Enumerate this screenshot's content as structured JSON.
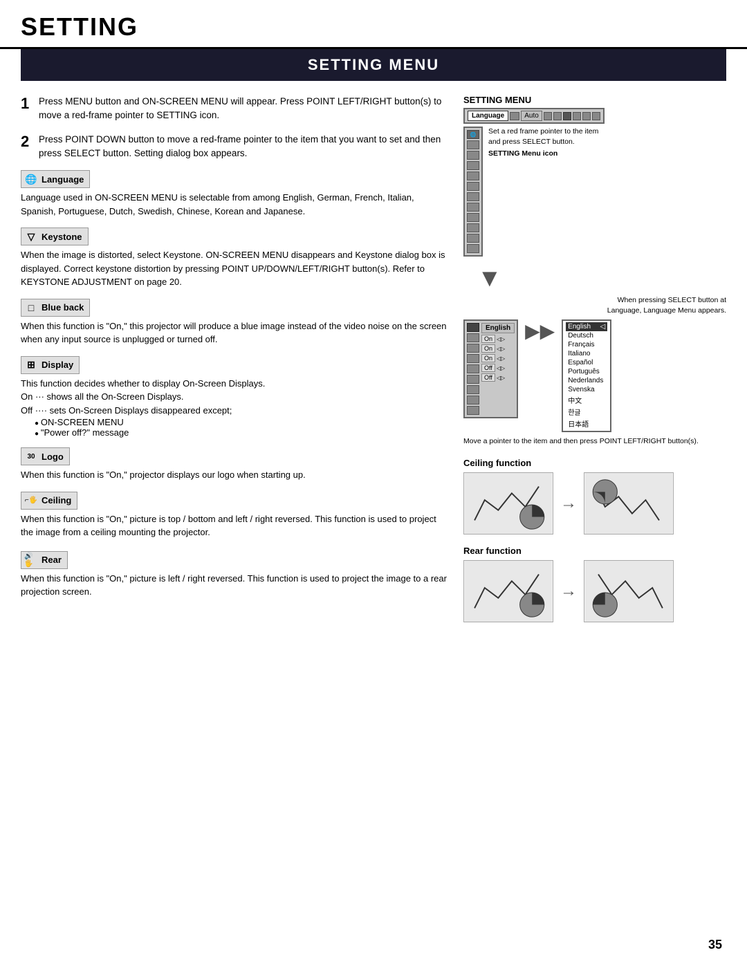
{
  "page": {
    "title": "SETTING",
    "section_title": "SETTING MENU",
    "page_number": "35"
  },
  "steps": [
    {
      "num": "1",
      "text": "Press MENU button and ON-SCREEN MENU will appear.  Press POINT LEFT/RIGHT button(s) to move a red-frame pointer to SETTING icon."
    },
    {
      "num": "2",
      "text": "Press POINT DOWN button to move a red-frame pointer to the item that you want to set and then press SELECT button.  Setting dialog box appears."
    }
  ],
  "features": [
    {
      "id": "language",
      "icon": "🌐",
      "label": "Language",
      "text": "Language used in ON-SCREEN MENU is selectable from among English, German, French, Italian, Spanish, Portuguese, Dutch, Swedish, Chinese, Korean and Japanese."
    },
    {
      "id": "keystone",
      "icon": "▽",
      "label": "Keystone",
      "text": "When the image is distorted, select Keystone.  ON-SCREEN MENU disappears and Keystone dialog box is displayed.  Correct keystone distortion by pressing POINT UP/DOWN/LEFT/RIGHT button(s).  Refer to KEYSTONE ADJUSTMENT on page 20."
    },
    {
      "id": "blue_back",
      "icon": "□",
      "label": "Blue back",
      "text": "When this function is \"On,\" this projector will produce a blue image instead of the video noise on the screen when any input source is unplugged or turned off."
    },
    {
      "id": "display",
      "icon": "⊞",
      "label": "Display",
      "text": "This function decides whether to display On-Screen Displays.",
      "bullets": [
        "On ··· shows all the On-Screen Displays.",
        "Off ···· sets On-Screen Displays disappeared except;"
      ],
      "sub_bullets": [
        "ON-SCREEN MENU",
        "\"Power off?\" message"
      ]
    },
    {
      "id": "logo",
      "icon": "30",
      "label": "Logo",
      "text": "When this function is \"On,\" projector displays our logo when starting up."
    },
    {
      "id": "ceiling",
      "icon": "⌐",
      "label": "Ceiling",
      "text": "When this function is \"On,\" picture is top / bottom and left / right reversed.  This function is used to project the image from a ceiling mounting the projector."
    },
    {
      "id": "rear",
      "icon": "🔊",
      "label": "Rear",
      "text": "When this function is \"On,\" picture is left / right reversed.  This function is used to project the image to a rear projection screen."
    }
  ],
  "right_panel": {
    "setting_menu_label": "SETTING MENU",
    "menu_bar": {
      "language_label": "Language",
      "auto_label": "Auto"
    },
    "annotation_red_frame": "Set a red frame pointer to the item and press SELECT button.",
    "annotation_icon": "SETTING Menu icon",
    "when_pressing_note": "When pressing SELECT button at Language, Language Menu appears.",
    "language_current": "English",
    "language_list": [
      {
        "label": "English",
        "selected": true
      },
      {
        "label": "Deutsch"
      },
      {
        "label": "Français"
      },
      {
        "label": "Italiano"
      },
      {
        "label": "Español"
      },
      {
        "label": "Português"
      },
      {
        "label": "Nederlands"
      },
      {
        "label": "Svenska"
      },
      {
        "label": "中文"
      },
      {
        "label": "한글"
      },
      {
        "label": "日本語"
      }
    ],
    "menu_rows": [
      {
        "label": "On",
        "show_arrows": true
      },
      {
        "label": "On",
        "show_arrows": true
      },
      {
        "label": "On",
        "show_arrows": true
      },
      {
        "label": "Off",
        "show_arrows": true
      },
      {
        "label": "Off",
        "show_arrows": true
      }
    ],
    "move_note": "Move a pointer to the item and then press POINT LEFT/RIGHT button(s).",
    "ceiling_function_label": "Ceiling function",
    "rear_function_label": "Rear function"
  }
}
